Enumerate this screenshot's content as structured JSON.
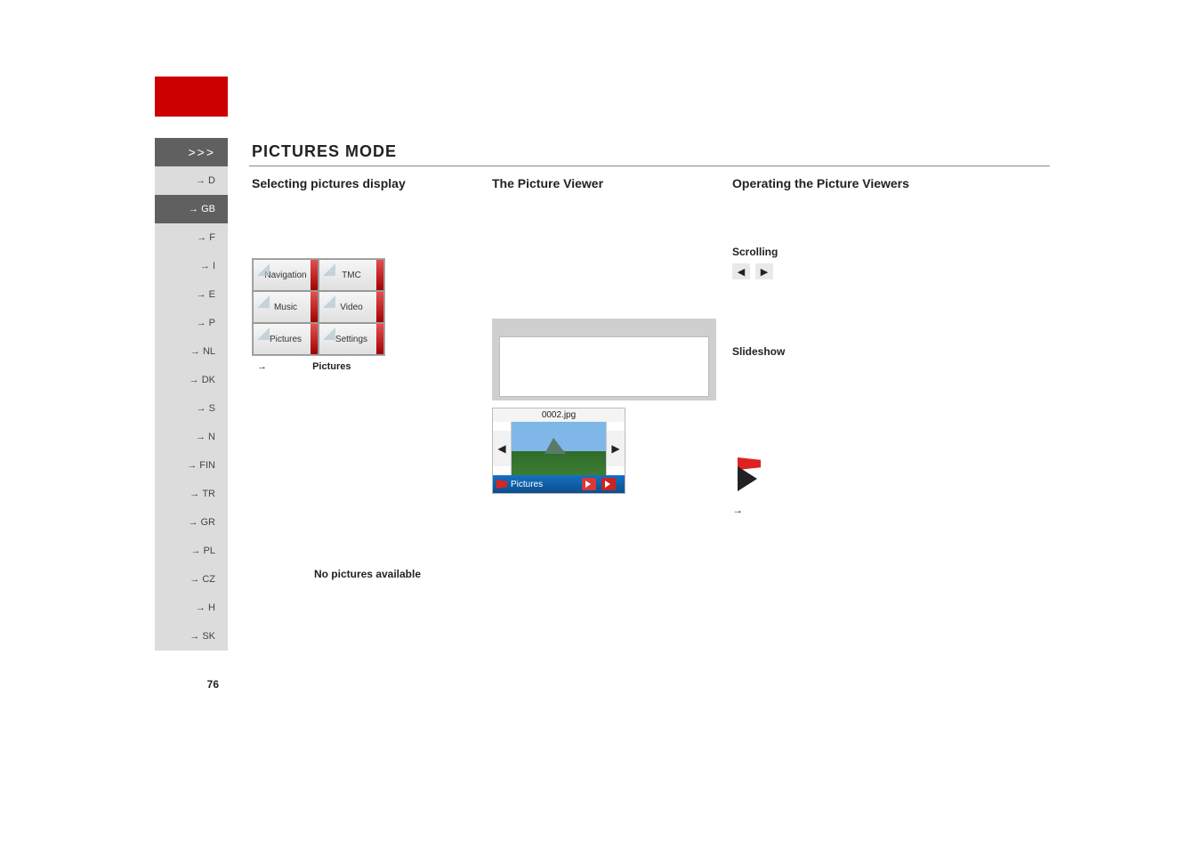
{
  "header": {
    "arrows": ">>>",
    "title": "PICTURES MODE"
  },
  "sidebar": {
    "items": [
      {
        "code": "D",
        "active": false
      },
      {
        "code": "GB",
        "active": true
      },
      {
        "code": "F",
        "active": false
      },
      {
        "code": "I",
        "active": false
      },
      {
        "code": "E",
        "active": false
      },
      {
        "code": "P",
        "active": false
      },
      {
        "code": "NL",
        "active": false
      },
      {
        "code": "DK",
        "active": false
      },
      {
        "code": "S",
        "active": false
      },
      {
        "code": "N",
        "active": false
      },
      {
        "code": "FIN",
        "active": false
      },
      {
        "code": "TR",
        "active": false
      },
      {
        "code": "GR",
        "active": false
      },
      {
        "code": "PL",
        "active": false
      },
      {
        "code": "CZ",
        "active": false
      },
      {
        "code": "H",
        "active": false
      },
      {
        "code": "SK",
        "active": false
      }
    ]
  },
  "col1": {
    "heading": "Selecting pictures display",
    "menu": {
      "rows": [
        [
          "Navigation",
          "TMC"
        ],
        [
          "Music",
          "Video"
        ],
        [
          "Pictures",
          "Settings"
        ]
      ]
    },
    "menu_caption_arrow": "→",
    "menu_caption": "Pictures",
    "no_pictures": "No pictures available"
  },
  "col2": {
    "heading": "The Picture Viewer",
    "viewer": {
      "filename": "0002.jpg",
      "prev": "◀",
      "next": "▶",
      "bottom_label": "Pictures"
    }
  },
  "col3": {
    "heading": "Operating the Picture Viewers",
    "scrolling_label": "Scrolling",
    "scroll_prev": "◀",
    "scroll_next": "▶",
    "slideshow_label": "Slideshow",
    "play_caption_arrow": "→"
  },
  "page_number": "76"
}
